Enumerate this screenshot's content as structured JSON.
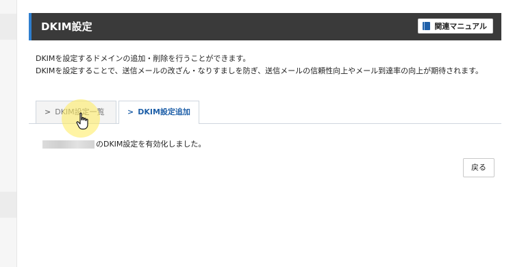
{
  "panel": {
    "title": "DKIM設定",
    "manual_label": "関連マニュアル"
  },
  "description": {
    "line1": "DKIMを設定するドメインの追加・削除を行うことができます。",
    "line2": "DKIMを設定することで、送信メールの改ざん・なりすましを防ぎ、送信メールの信頼性向上やメール到達率の向上が期待されます。"
  },
  "tabs": [
    {
      "label": "DKIM設定一覧",
      "active": false
    },
    {
      "label": "DKIM設定追加",
      "active": true
    }
  ],
  "message": {
    "text": "のDKIM設定を有効化しました。"
  },
  "buttons": {
    "back_label": "戻る"
  },
  "colors": {
    "header_bg": "#3a3a3a",
    "accent": "#2f7fcf",
    "active_tab_text": "#1e5fa8"
  },
  "icons": {
    "manual": "book-icon",
    "tab_marker": "chevron-right-icon",
    "cursor": "hand-pointer-icon"
  }
}
